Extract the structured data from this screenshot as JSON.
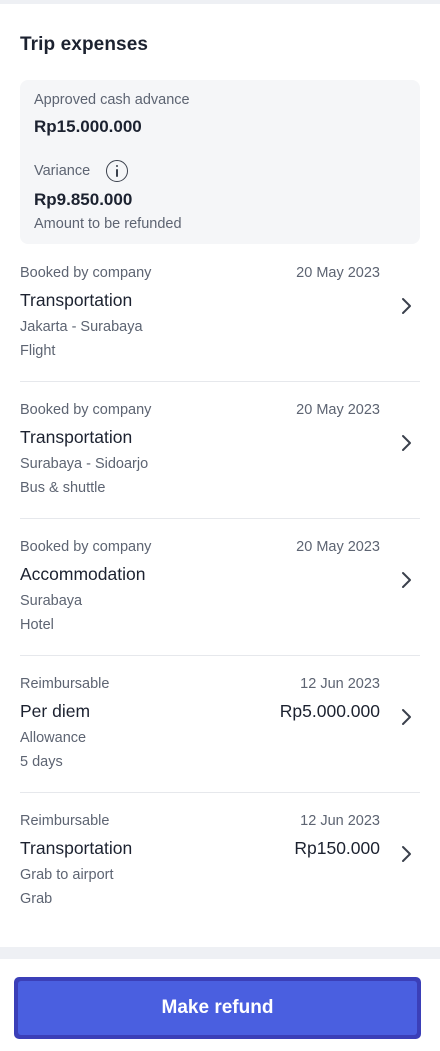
{
  "page": {
    "title": "Trip expenses"
  },
  "summary": {
    "advance_label": "Approved cash advance",
    "advance_value": "Rp15.000.000",
    "variance_label": "Variance",
    "variance_value": "Rp9.850.000",
    "variance_note": "Amount to be refunded"
  },
  "expenses": [
    {
      "kind": "Booked by company",
      "date": "20 May 2023",
      "title": "Transportation",
      "price": "",
      "sub1": "Jakarta - Surabaya",
      "sub2": "Flight"
    },
    {
      "kind": "Booked by company",
      "date": "20 May 2023",
      "title": "Transportation",
      "price": "",
      "sub1": "Surabaya - Sidoarjo",
      "sub2": "Bus & shuttle"
    },
    {
      "kind": "Booked by company",
      "date": "20 May 2023",
      "title": "Accommodation",
      "price": "",
      "sub1": "Surabaya",
      "sub2": "Hotel"
    },
    {
      "kind": "Reimbursable",
      "date": "12 Jun 2023",
      "title": "Per diem",
      "price": "Rp5.000.000",
      "sub1": "Allowance",
      "sub2": "5 days"
    },
    {
      "kind": "Reimbursable",
      "date": "12 Jun 2023",
      "title": "Transportation",
      "price": "Rp150.000",
      "sub1": "Grab to airport",
      "sub2": "Grab"
    }
  ],
  "footer": {
    "cta_label": "Make refund"
  },
  "icons": {
    "info": "info-icon",
    "chevron": "chevron-right-icon"
  },
  "colors": {
    "accent": "#4a5fe0",
    "accent_border": "#3b3fb8",
    "muted_text": "#5d6472",
    "card_bg": "#f5f6f8"
  }
}
